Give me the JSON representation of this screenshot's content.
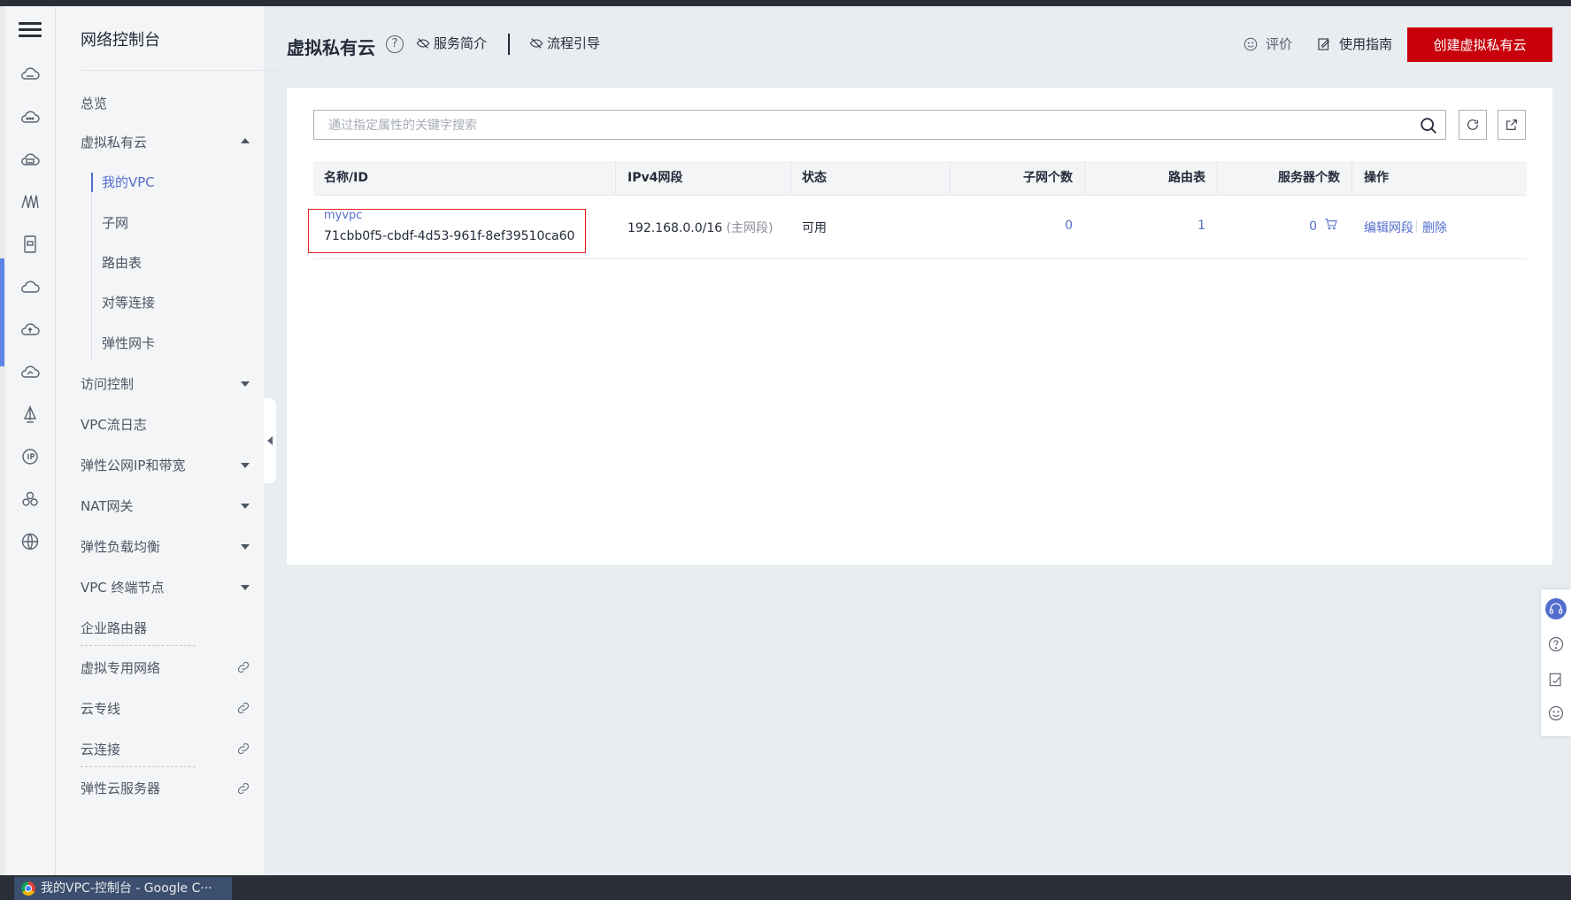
{
  "header": {
    "title": "虚拟私有云",
    "service_intro": "服务简介",
    "process_guide": "流程引导",
    "rate": "评价",
    "usage_guide": "使用指南",
    "create_button": "创建虚拟私有云"
  },
  "sidebar": {
    "title": "网络控制台",
    "items": {
      "overview": "总览",
      "vpc": "虚拟私有云",
      "my_vpc": "我的VPC",
      "subnet": "子网",
      "route_table": "路由表",
      "peering": "对等连接",
      "eni": "弹性网卡",
      "access_control": "访问控制",
      "flow_log": "VPC流日志",
      "eip": "弹性公网IP和带宽",
      "nat": "NAT网关",
      "elb": "弹性负载均衡",
      "vpcep": "VPC 终端节点",
      "enterprise_router": "企业路由器",
      "vpn": "虚拟专用网络",
      "direct_connect": "云专线",
      "cloud_connect": "云连接",
      "ecs": "弹性云服务器"
    }
  },
  "search": {
    "placeholder": "通过指定属性的关键字搜索"
  },
  "table": {
    "columns": {
      "name_id": "名称/ID",
      "ipv4": "IPv4网段",
      "status": "状态",
      "subnets": "子网个数",
      "route_tables": "路由表",
      "servers": "服务器个数",
      "actions": "操作"
    },
    "rows": [
      {
        "name": "myvpc",
        "id": "71cbb0f5-cbdf-4d53-961f-8ef39510ca60",
        "ipv4": "192.168.0.0/16",
        "ipv4_note": "(主网段)",
        "status": "可用",
        "subnets": "0",
        "route_tables": "1",
        "servers": "0",
        "edit": "编辑网段",
        "delete": "删除"
      }
    ]
  },
  "taskbar": {
    "window_title": "我的VPC-控制台 - Google C···"
  },
  "colors": {
    "primary_button": "#c7000b",
    "link": "#526ecc",
    "highlight_box": "#e02020"
  }
}
